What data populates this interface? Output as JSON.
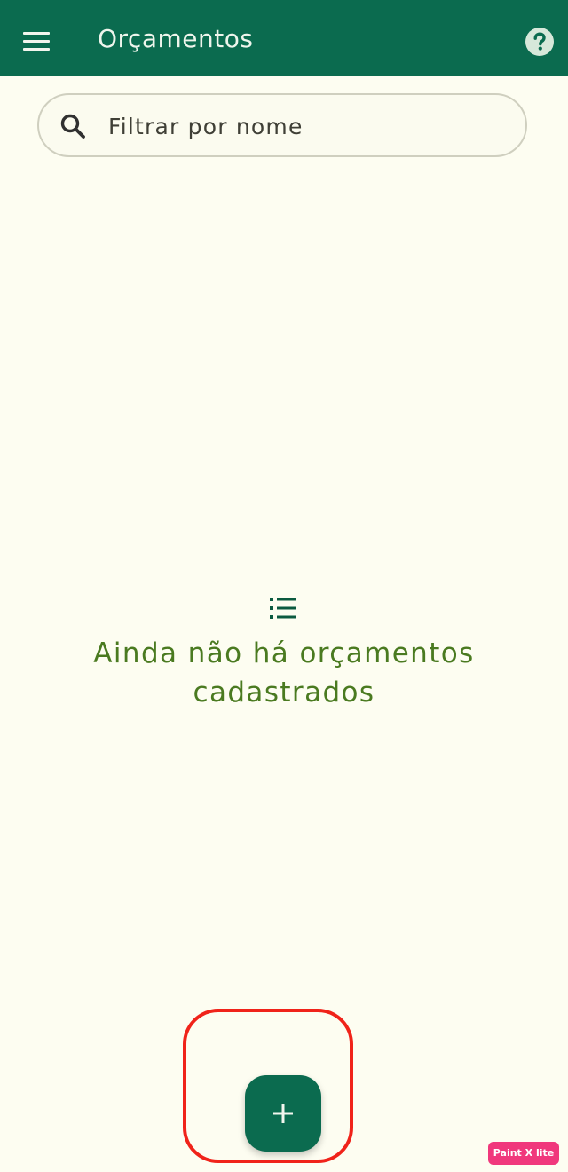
{
  "appbar": {
    "title": "Orçamentos",
    "menu_icon": "menu-icon",
    "help_icon": "help-circle-icon",
    "color": "#0B6B4F"
  },
  "search": {
    "placeholder": "Filtrar por nome",
    "value": "",
    "icon": "search-icon"
  },
  "empty_state": {
    "icon": "list-icon",
    "message": "Ainda não há orçamentos cadastrados",
    "color": "#4A7A20"
  },
  "fab": {
    "icon": "plus-icon",
    "color": "#0B6B4F"
  },
  "annotation": {
    "color": "#F0231A"
  },
  "watermark": {
    "text": "Paint X lite",
    "color": "#F0387C"
  }
}
